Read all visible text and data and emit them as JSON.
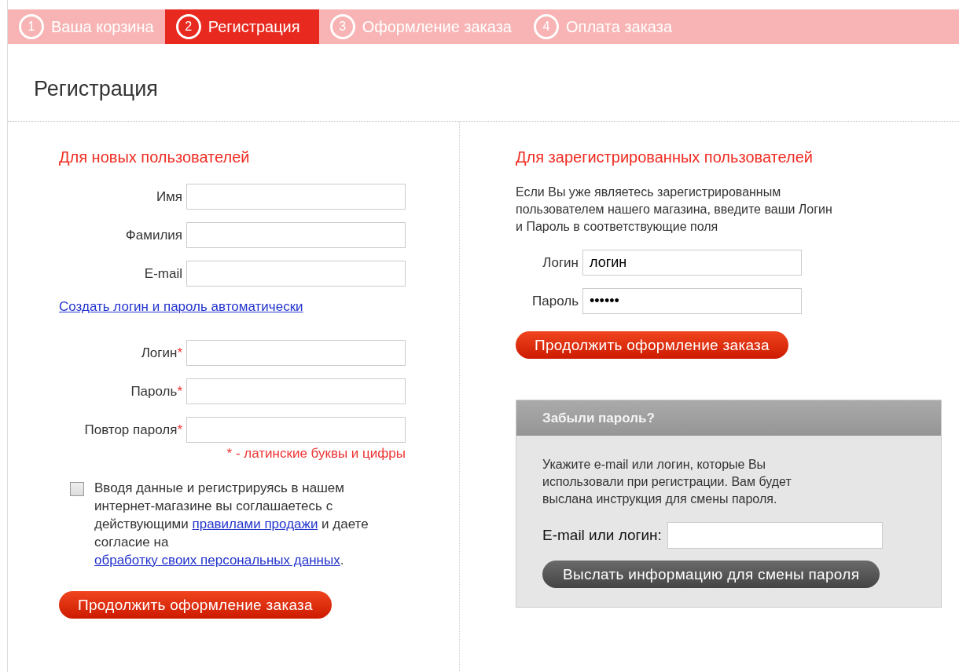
{
  "steps": [
    {
      "number": "1",
      "label": "Ваша корзина",
      "selected": false
    },
    {
      "number": "2",
      "label": "Регистрация",
      "selected": true
    },
    {
      "number": "3",
      "label": "Оформление заказа",
      "selected": false
    },
    {
      "number": "4",
      "label": "Оплата заказа",
      "selected": false
    }
  ],
  "page_title": "Регистрация",
  "new_users": {
    "title": "Для новых пользователей",
    "fields": [
      {
        "label": "Имя"
      },
      {
        "label": "Фамилия"
      },
      {
        "label": "E-mail"
      }
    ],
    "auto_link": "Создать логин и пароль автоматически",
    "credential_fields": [
      {
        "label": "Логин",
        "required_mark": "*"
      },
      {
        "label": "Пароль",
        "required_mark": "*"
      },
      {
        "label": "Повтор пароля",
        "required_mark": "*"
      }
    ],
    "note": "* - латинские буквы и цифры",
    "consent": {
      "checked": false,
      "parts": [
        {
          "kind": "text",
          "text": "Вводя данные и регистрируясь в нашем интернет-магазине вы соглашаетесь с действующими "
        },
        {
          "kind": "link",
          "text": "правилами продажи"
        },
        {
          "kind": "text",
          "text": " и даете согласие на "
        },
        {
          "kind": "link",
          "text": "обработку своих персональных данных"
        },
        {
          "kind": "text",
          "text": "."
        }
      ]
    },
    "button": "Продолжить оформление заказа"
  },
  "registered_users": {
    "title": "Для зарегистрированных пользователей",
    "intro": "Если Вы уже являетесь зарегистрированным пользователем нашего магазина, введите ваши Логин и Пароль в соответствующие поля",
    "login_field": {
      "label": "Логин",
      "value": "логин"
    },
    "password_field": {
      "label": "Пароль",
      "value": "••••••"
    },
    "button": "Продолжить оформление заказа"
  },
  "forgot_password": {
    "title": "Забыли пароль?",
    "text": "Укажите e-mail или логин, которые Вы использовали при регистрации. Вам будет выслана инструкция для смены пароля.",
    "field_label": "E-mail или логин:",
    "button": "Выслать информацию для смены пароля"
  }
}
